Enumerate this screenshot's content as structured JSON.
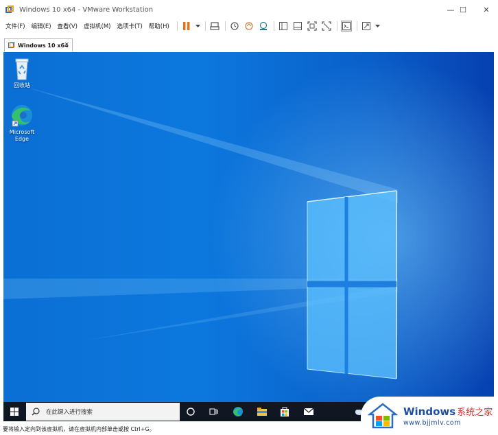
{
  "window": {
    "title": "Windows 10 x64 - VMware Workstation",
    "controls": {
      "minimize": "—",
      "maximize": "☐",
      "close": "✕"
    }
  },
  "menu": {
    "items": [
      "文件(F)",
      "编辑(E)",
      "查看(V)",
      "虚拟机(M)",
      "选项卡(T)",
      "帮助(H)"
    ]
  },
  "toolbar": {
    "buttons": [
      "pause-icon",
      "send-keys-icon",
      "snapshot-icon",
      "revert-snapshot-icon",
      "snapshot-manager-icon",
      "library-icon",
      "thumbnail-icon",
      "fullscreen-icon",
      "unity-icon",
      "console-icon",
      "stretch-icon"
    ],
    "accent": "#e8711c"
  },
  "tab": {
    "label": "Windows 10 x64",
    "close": "×"
  },
  "desktop": {
    "icons": [
      {
        "label": "回收站"
      },
      {
        "label_line1": "Microsoft",
        "label_line2": "Edge"
      }
    ]
  },
  "taskbar": {
    "search_placeholder": "在此键入进行搜索",
    "icons": [
      "cortana-icon",
      "task-view-icon",
      "edge-icon",
      "file-explorer-icon",
      "store-icon",
      "mail-icon",
      "weather-icon"
    ]
  },
  "statusbar": {
    "text": "要将输入定向到该虚拟机，请在虚拟机内部单击或按 Ctrl+G。"
  },
  "watermark": {
    "brand": "Windows",
    "suffix": "系统之家",
    "url": "www.bjjmlv.com"
  }
}
